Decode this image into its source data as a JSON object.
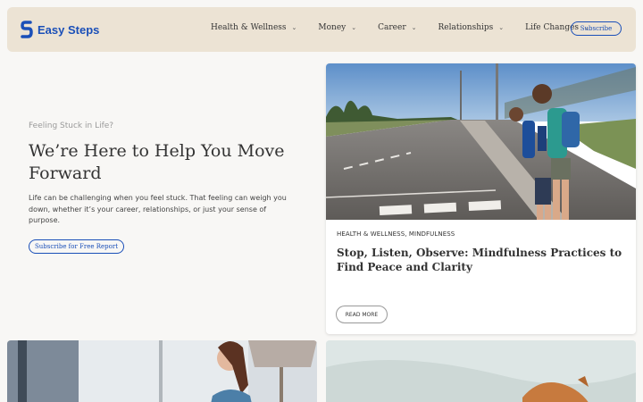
{
  "header": {
    "brand": "Easy Steps",
    "nav": [
      {
        "label": "Health & Wellness"
      },
      {
        "label": "Money"
      },
      {
        "label": "Career"
      },
      {
        "label": "Relationships"
      },
      {
        "label": "Life Changes"
      }
    ],
    "subscribe_label": "Subscribe"
  },
  "hero": {
    "eyebrow": "Feeling Stuck in Life?",
    "title": "We’re Here to Help You Move Forward",
    "description": "Life can be challenging when you feel stuck. That feeling can weigh you down, whether it’s your career, relationships, or just your sense of purpose.",
    "cta_label": "Subscribe for Free Report"
  },
  "featured_post": {
    "categories": "HEALTH & WELLNESS, MINDFULNESS",
    "title": "Stop, Listen, Observe: Mindfulness Practices to Find Peace and Clarity",
    "read_more_label": "READ MORE"
  },
  "colors": {
    "brand_blue": "#1a4fb8",
    "header_bg": "#ece3d4",
    "page_bg": "#f8f7f5"
  }
}
